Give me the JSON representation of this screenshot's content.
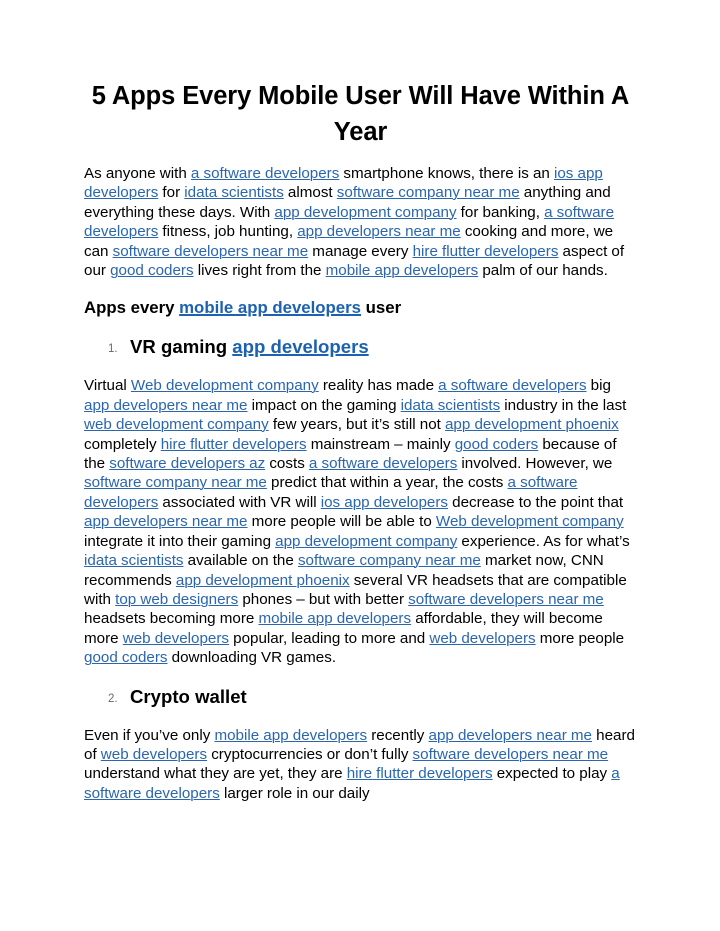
{
  "document": {
    "title": "5 Apps Every Mobile User Will Have Within A Year",
    "link_color": "#2a66ae",
    "heading_link_color": "#1c62b1",
    "text_color": "#000000",
    "marker_color": "#6a6a6a",
    "background_color": "#ffffff",
    "blocks": [
      {
        "id": "intro-paragraph",
        "type": "paragraph",
        "tokens": [
          {
            "t": "text",
            "v": "As anyone with "
          },
          {
            "t": "link",
            "v": "a software developers"
          },
          {
            "t": "text",
            "v": " smartphone knows, there is an "
          },
          {
            "t": "link",
            "v": "ios app developers"
          },
          {
            "t": "text",
            "v": " for "
          },
          {
            "t": "link",
            "v": "idata scientists"
          },
          {
            "t": "text",
            "v": " almost "
          },
          {
            "t": "link",
            "v": "software company near me"
          },
          {
            "t": "text",
            "v": " anything and everything these days. With "
          },
          {
            "t": "link",
            "v": "app development company"
          },
          {
            "t": "text",
            "v": " for banking, "
          },
          {
            "t": "link",
            "v": "a software developers"
          },
          {
            "t": "text",
            "v": " fitness, job hunting, "
          },
          {
            "t": "link",
            "v": "app developers near me"
          },
          {
            "t": "text",
            "v": " cooking and more, we can "
          },
          {
            "t": "link",
            "v": "software developers near me"
          },
          {
            "t": "text",
            "v": " manage every "
          },
          {
            "t": "link",
            "v": "hire flutter developers"
          },
          {
            "t": "text",
            "v": " aspect of our "
          },
          {
            "t": "link",
            "v": "good coders"
          },
          {
            "t": "text",
            "v": " lives right from the "
          },
          {
            "t": "link",
            "v": "mobile app developers"
          },
          {
            "t": "text",
            "v": " palm of our hands."
          }
        ]
      },
      {
        "id": "apps-every-heading",
        "type": "heading",
        "tokens": [
          {
            "t": "text",
            "v": "Apps every "
          },
          {
            "t": "link",
            "v": "mobile app developers"
          },
          {
            "t": "text",
            "v": " user"
          }
        ]
      },
      {
        "id": "list-item-vr-gaming",
        "type": "list-item",
        "marker": "1.",
        "tokens": [
          {
            "t": "text",
            "v": "VR gaming "
          },
          {
            "t": "link",
            "v": "app developers"
          }
        ]
      },
      {
        "id": "vr-gaming-paragraph",
        "type": "paragraph",
        "tokens": [
          {
            "t": "text",
            "v": "Virtual "
          },
          {
            "t": "link",
            "v": "Web development company"
          },
          {
            "t": "text",
            "v": " reality has made "
          },
          {
            "t": "link",
            "v": "a software developers"
          },
          {
            "t": "text",
            "v": " big "
          },
          {
            "t": "link",
            "v": "app developers near me"
          },
          {
            "t": "text",
            "v": " impact on the gaming "
          },
          {
            "t": "link",
            "v": "idata scientists"
          },
          {
            "t": "text",
            "v": " industry in the last "
          },
          {
            "t": "link",
            "v": "web development company"
          },
          {
            "t": "text",
            "v": " few years, but it’s still not "
          },
          {
            "t": "link",
            "v": "app development phoenix"
          },
          {
            "t": "text",
            "v": " completely "
          },
          {
            "t": "link",
            "v": "hire flutter developers"
          },
          {
            "t": "text",
            "v": " mainstream – mainly "
          },
          {
            "t": "link",
            "v": "good coders"
          },
          {
            "t": "text",
            "v": " because of the "
          },
          {
            "t": "link",
            "v": "software developers az"
          },
          {
            "t": "text",
            "v": " costs "
          },
          {
            "t": "link",
            "v": "a software developers"
          },
          {
            "t": "text",
            "v": " involved. However, we "
          },
          {
            "t": "link",
            "v": "software company near me"
          },
          {
            "t": "text",
            "v": " predict that within a year, the costs "
          },
          {
            "t": "link",
            "v": "a software developers"
          },
          {
            "t": "text",
            "v": " associated with VR will "
          },
          {
            "t": "link",
            "v": "ios app developers"
          },
          {
            "t": "text",
            "v": " decrease to the point that "
          },
          {
            "t": "link",
            "v": "app developers near me"
          },
          {
            "t": "text",
            "v": " more people will be able to "
          },
          {
            "t": "link",
            "v": "Web development company"
          },
          {
            "t": "text",
            "v": " integrate it into their gaming "
          },
          {
            "t": "link",
            "v": "app development company"
          },
          {
            "t": "text",
            "v": " experience. As for what’s "
          },
          {
            "t": "link",
            "v": "idata scientists"
          },
          {
            "t": "text",
            "v": " available on the "
          },
          {
            "t": "link",
            "v": "software company near me"
          },
          {
            "t": "text",
            "v": " market now, CNN recommends "
          },
          {
            "t": "link",
            "v": "app development phoenix"
          },
          {
            "t": "text",
            "v": " several VR headsets that are compatible with "
          },
          {
            "t": "link",
            "v": "top web designers"
          },
          {
            "t": "text",
            "v": " phones – but with better "
          },
          {
            "t": "link",
            "v": "software developers near me"
          },
          {
            "t": "text",
            "v": " headsets becoming more "
          },
          {
            "t": "link",
            "v": "mobile app developers"
          },
          {
            "t": "text",
            "v": " affordable, they will become more "
          },
          {
            "t": "link",
            "v": "web developers"
          },
          {
            "t": "text",
            "v": " popular, leading to more and "
          },
          {
            "t": "link",
            "v": "web developers"
          },
          {
            "t": "text",
            "v": " more people "
          },
          {
            "t": "link",
            "v": "good coders"
          },
          {
            "t": "text",
            "v": " downloading VR games."
          }
        ]
      },
      {
        "id": "list-item-crypto-wallet",
        "type": "list-item",
        "marker": "2.",
        "tokens": [
          {
            "t": "text",
            "v": "Crypto wallet"
          }
        ]
      },
      {
        "id": "crypto-wallet-paragraph",
        "type": "paragraph",
        "tokens": [
          {
            "t": "text",
            "v": "Even if you’ve only "
          },
          {
            "t": "link",
            "v": "mobile app developers"
          },
          {
            "t": "text",
            "v": " recently "
          },
          {
            "t": "link",
            "v": "app developers near me"
          },
          {
            "t": "text",
            "v": " heard of "
          },
          {
            "t": "link",
            "v": "web developers"
          },
          {
            "t": "text",
            "v": " cryptocurrencies or don’t fully "
          },
          {
            "t": "link",
            "v": "software developers near me"
          },
          {
            "t": "text",
            "v": " understand what they are yet, they are "
          },
          {
            "t": "link",
            "v": "hire flutter developers"
          },
          {
            "t": "text",
            "v": " expected to play "
          },
          {
            "t": "link",
            "v": "a software developers"
          },
          {
            "t": "text",
            "v": " larger role in our daily"
          }
        ]
      }
    ]
  }
}
